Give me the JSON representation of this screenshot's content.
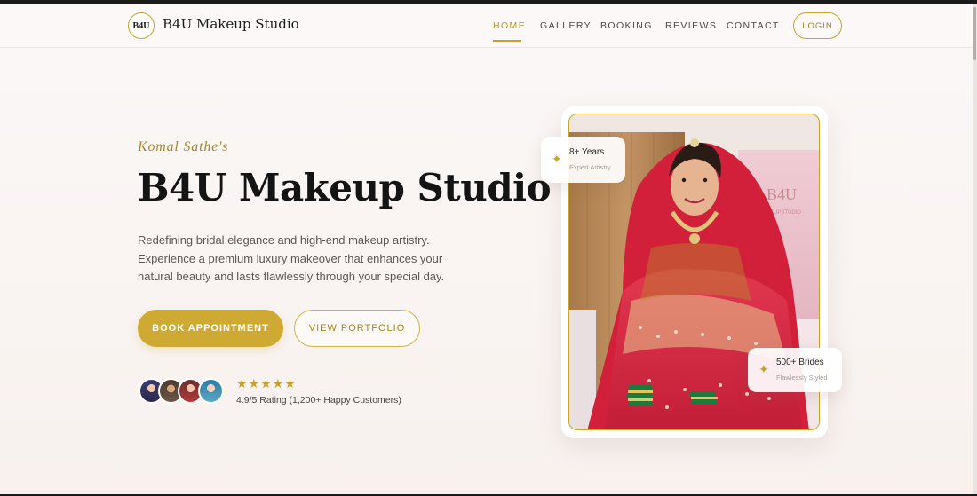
{
  "nav": {
    "logo_text": "B4U",
    "brand": "B4U Makeup Studio",
    "links": [
      {
        "label": "HOME",
        "active": true
      },
      {
        "label": "GALLERY",
        "active": false
      },
      {
        "label": "BOOKING",
        "active": false
      },
      {
        "label": "REVIEWS",
        "active": false
      },
      {
        "label": "CONTACT",
        "active": false
      }
    ],
    "login": "LOGIN"
  },
  "hero": {
    "eyebrow": "Komal Sathe's",
    "title": "B4U Makeup Studio",
    "description_lines": [
      "Redefining bridal elegance and high-end makeup artistry.",
      "Experience a premium luxury makeover that enhances your",
      "natural beauty and lasts flawlessly through your special day."
    ],
    "primary_button": "BOOK APPOINTMENT",
    "secondary_button": "VIEW PORTFOLIO",
    "stars": "★★★★★",
    "rating_text": "4.9/5 Rating (1,200+ Happy Customers)"
  },
  "badges": {
    "experience": {
      "title": "8+ Years",
      "subtitle": "Expert Artistry"
    },
    "brides": {
      "title": "500+ Brides",
      "subtitle": "Flawlessly Styled"
    }
  },
  "photo": {
    "wall_sign": "B4U",
    "wall_sign_sub": "MAKEUPSTUDIO"
  },
  "icons": {
    "badge_icon": "sparkle-icon",
    "avatar_icon": "avatar-photo"
  },
  "colors": {
    "accent": "#c9a227",
    "background": "#fbf8f7",
    "text": "#141414"
  }
}
